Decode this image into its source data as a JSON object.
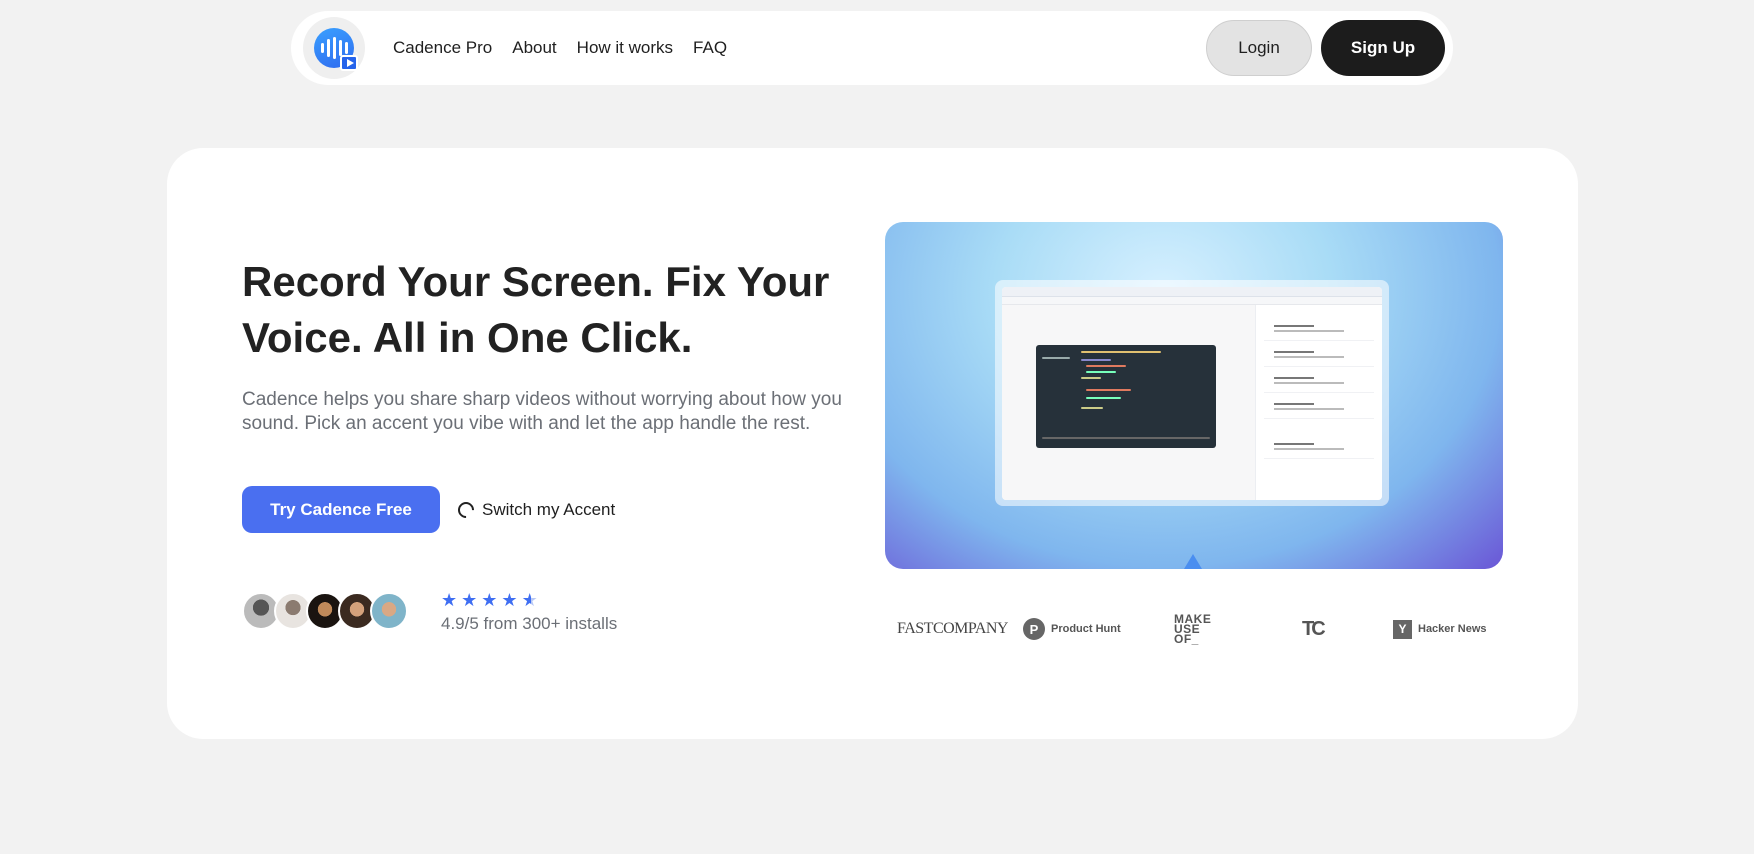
{
  "nav": {
    "links": [
      "Cadence Pro",
      "About",
      "How it works",
      "FAQ"
    ],
    "login_label": "Login",
    "signup_label": "Sign Up"
  },
  "hero": {
    "headline": "Record Your Screen. Fix Your Voice. All in One Click.",
    "subtitle": "Cadence helps you share sharp videos without worrying about how you sound. Pick an accent you vibe with and let the app handle the rest.",
    "primary_cta": "Try Cadence Free",
    "secondary_cta": "Switch my Accent",
    "rating_text": "4.9/5 from 300+ installs",
    "stars": 4.5
  },
  "press": {
    "fast_company": "FASTCOMPANY",
    "product_hunt": "Product Hunt",
    "product_hunt_letter": "P",
    "make_use_of": [
      "MAKE",
      "USE",
      "OF_"
    ],
    "techcrunch": "TC",
    "hacker_news": "Hacker News",
    "hacker_news_letter": "Y"
  },
  "colors": {
    "accent": "#4a6ff0",
    "signup_bg": "#1c1c1c",
    "star": "#3f6ef2"
  }
}
